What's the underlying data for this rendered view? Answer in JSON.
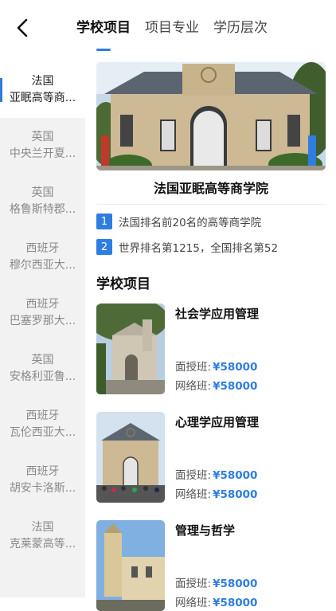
{
  "header": {
    "tabs": [
      {
        "label": "学校项目",
        "active": true
      },
      {
        "label": "项目专业",
        "active": false
      },
      {
        "label": "学历层次",
        "active": false
      }
    ]
  },
  "sidebar": {
    "items": [
      {
        "country": "法国",
        "name": "亚眠高等商...",
        "active": true
      },
      {
        "country": "英国",
        "name": "中央兰开夏..."
      },
      {
        "country": "英国",
        "name": "格鲁斯特郡..."
      },
      {
        "country": "西班牙",
        "name": "穆尔西亚大..."
      },
      {
        "country": "西班牙",
        "name": "巴塞罗那大..."
      },
      {
        "country": "英国",
        "name": "安格利亚鲁..."
      },
      {
        "country": "西班牙",
        "name": "瓦伦西亚大..."
      },
      {
        "country": "西班牙",
        "name": "胡安卡洛斯..."
      },
      {
        "country": "法国",
        "name": "克莱蒙高等..."
      }
    ]
  },
  "school": {
    "name": "法国亚眠高等商学院",
    "features": [
      {
        "num": "1",
        "text": "法国排名前20名的高等商学院"
      },
      {
        "num": "2",
        "text": "世界排名第1215，全国排名第52"
      }
    ]
  },
  "programs_section": {
    "title": "学校项目",
    "items": [
      {
        "name": "社会学应用管理",
        "face_label": "面授班:",
        "face_price": "¥58000",
        "online_label": "网络班:",
        "online_price": "¥58000"
      },
      {
        "name": "心理学应用管理",
        "face_label": "面授班:",
        "face_price": "¥58000",
        "online_label": "网络班:",
        "online_price": "¥58000"
      },
      {
        "name": "管理与哲学",
        "face_label": "面授班:",
        "face_price": "¥58000",
        "online_label": "网络班:",
        "online_price": "¥58000"
      }
    ]
  },
  "colors": {
    "accent": "#2f7de1",
    "sidebar_bg": "#f2f2f2"
  }
}
